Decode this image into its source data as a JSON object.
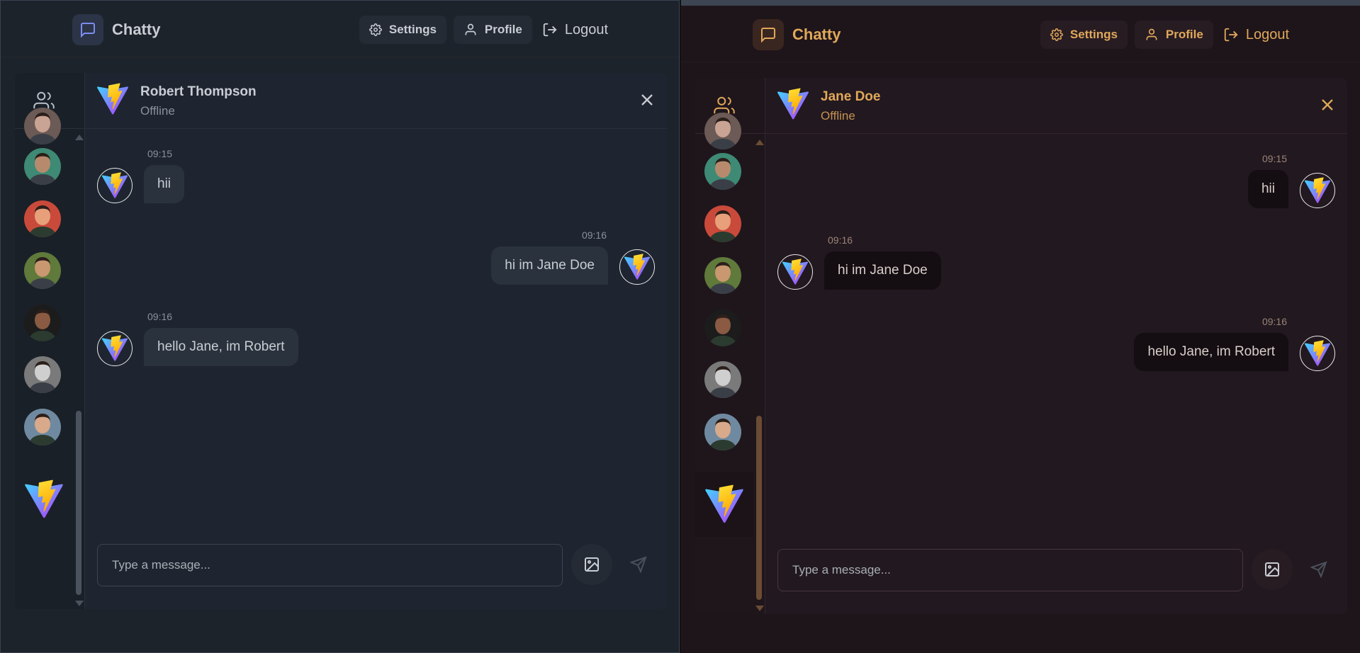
{
  "left": {
    "theme": "theme-blue",
    "brand": "Chatty",
    "nav": {
      "settings": "Settings",
      "profile": "Profile",
      "logout": "Logout"
    },
    "chat": {
      "name": "Robert Thompson",
      "status": "Offline"
    },
    "messages": [
      {
        "dir": "in",
        "time": "09:15",
        "text": "hii"
      },
      {
        "dir": "out",
        "time": "09:16",
        "text": "hi im Jane Doe"
      },
      {
        "dir": "in",
        "time": "09:16",
        "text": "hello Jane, im Robert"
      }
    ],
    "input_placeholder": "Type a message..."
  },
  "right": {
    "theme": "theme-amber",
    "brand": "Chatty",
    "nav": {
      "settings": "Settings",
      "profile": "Profile",
      "logout": "Logout"
    },
    "chat": {
      "name": "Jane Doe",
      "status": "Offline"
    },
    "messages": [
      {
        "dir": "out",
        "time": "09:15",
        "text": "hii"
      },
      {
        "dir": "in",
        "time": "09:16",
        "text": "hi im Jane Doe"
      },
      {
        "dir": "out",
        "time": "09:16",
        "text": "hello Jane, im Robert"
      }
    ],
    "input_placeholder": "Type a message..."
  },
  "contacts": [
    {
      "name": "contact-1",
      "skin": "#c9a393",
      "bg": "#6b5a55"
    },
    {
      "name": "contact-2",
      "skin": "#b78a6e",
      "bg": "#3e8a74"
    },
    {
      "name": "contact-3",
      "skin": "#e7a07a",
      "bg": "#c94a3a"
    },
    {
      "name": "contact-4",
      "skin": "#c99770",
      "bg": "#5f7a3a"
    },
    {
      "name": "contact-5",
      "skin": "#8a5a42",
      "bg": "#1c1c1c"
    },
    {
      "name": "contact-6",
      "skin": "#cfcfcf",
      "bg": "#7a7a7a"
    },
    {
      "name": "contact-7",
      "skin": "#d8a98a",
      "bg": "#6f8aa0"
    }
  ],
  "colors": {
    "blue_accent": "#6b7fd7",
    "amber_accent": "#e0a85a"
  },
  "icons": {
    "logo": "chat-bubble-icon",
    "settings": "gear-icon",
    "profile": "user-icon",
    "logout": "logout-icon",
    "contacts": "users-icon",
    "close": "close-icon",
    "image": "image-icon",
    "send": "send-icon",
    "avatar": "vite-bolt-logo"
  }
}
